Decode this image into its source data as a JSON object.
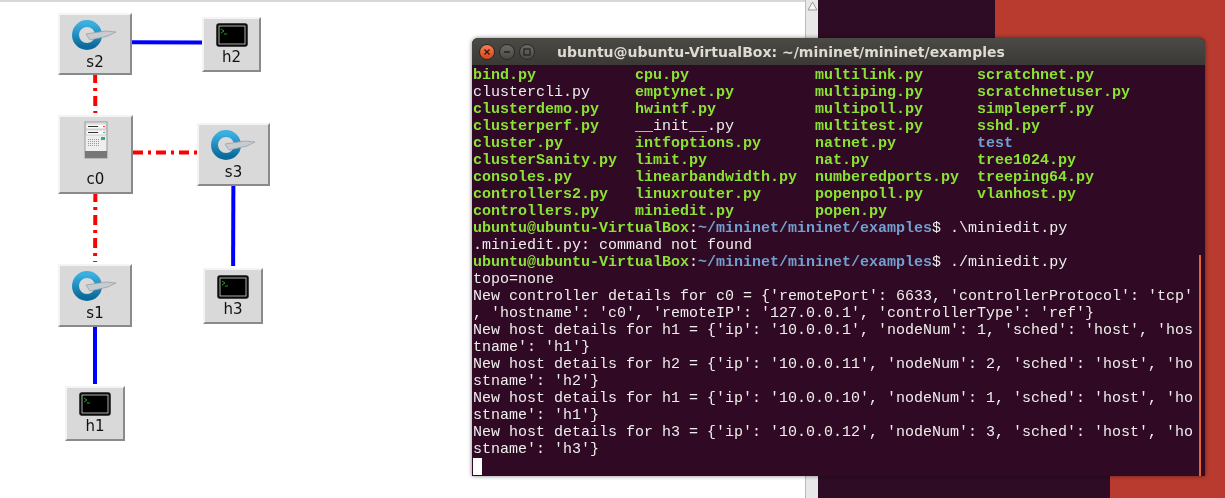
{
  "topology": {
    "nodes": [
      {
        "label": "s2",
        "kind": "switch"
      },
      {
        "label": "h2",
        "kind": "host"
      },
      {
        "label": "c0",
        "kind": "controller"
      },
      {
        "label": "s3",
        "kind": "switch"
      },
      {
        "label": "s1",
        "kind": "switch"
      },
      {
        "label": "h3",
        "kind": "host"
      },
      {
        "label": "h1",
        "kind": "host"
      }
    ],
    "links": [
      {
        "kind": "data"
      },
      {
        "kind": "control"
      },
      {
        "kind": "control"
      },
      {
        "kind": "control"
      },
      {
        "kind": "data"
      },
      {
        "kind": "data"
      }
    ]
  },
  "terminal": {
    "title": "ubuntu@ubuntu-VirtualBox: ~/mininet/mininet/examples",
    "listing": [
      [
        {
          "name": "bind.py",
          "kind": "file"
        },
        {
          "name": "clustercli.py",
          "kind": "plain"
        },
        {
          "name": "clusterdemo.py",
          "kind": "file"
        },
        {
          "name": "clusterperf.py",
          "kind": "file"
        },
        {
          "name": "cluster.py",
          "kind": "file"
        },
        {
          "name": "clusterSanity.py",
          "kind": "file"
        },
        {
          "name": "consoles.py",
          "kind": "file"
        },
        {
          "name": "controllers2.py",
          "kind": "file"
        },
        {
          "name": "controllers.py",
          "kind": "file"
        }
      ],
      [
        {
          "name": "cpu.py",
          "kind": "file"
        },
        {
          "name": "emptynet.py",
          "kind": "file"
        },
        {
          "name": "hwintf.py",
          "kind": "file"
        },
        {
          "name": "__init__.py",
          "kind": "plain"
        },
        {
          "name": "intfoptions.py",
          "kind": "file"
        },
        {
          "name": "limit.py",
          "kind": "file"
        },
        {
          "name": "linearbandwidth.py",
          "kind": "file"
        },
        {
          "name": "linuxrouter.py",
          "kind": "file"
        },
        {
          "name": "miniedit.py",
          "kind": "file"
        }
      ],
      [
        {
          "name": "multilink.py",
          "kind": "file"
        },
        {
          "name": "multiping.py",
          "kind": "file"
        },
        {
          "name": "multipoll.py",
          "kind": "file"
        },
        {
          "name": "multitest.py",
          "kind": "file"
        },
        {
          "name": "natnet.py",
          "kind": "file"
        },
        {
          "name": "nat.py",
          "kind": "file"
        },
        {
          "name": "numberedports.py",
          "kind": "file"
        },
        {
          "name": "popenpoll.py",
          "kind": "file"
        },
        {
          "name": "popen.py",
          "kind": "file"
        }
      ],
      [
        {
          "name": "scratchnet.py",
          "kind": "file"
        },
        {
          "name": "scratchnetuser.py",
          "kind": "file"
        },
        {
          "name": "simpleperf.py",
          "kind": "file"
        },
        {
          "name": "sshd.py",
          "kind": "file"
        },
        {
          "name": "test",
          "kind": "dir"
        },
        {
          "name": "tree1024.py",
          "kind": "file"
        },
        {
          "name": "treeping64.py",
          "kind": "file"
        },
        {
          "name": "vlanhost.py",
          "kind": "file"
        }
      ]
    ],
    "lines": [
      {
        "kind": "prompt",
        "user": "ubuntu@ubuntu-VirtualBox",
        "separator": ":",
        "path": "~/mininet/mininet/examples",
        "symbol": "$",
        "command": ".\\miniedit.py"
      },
      {
        "kind": "output",
        "text": ".miniedit.py: command not found"
      },
      {
        "kind": "prompt",
        "user": "ubuntu@ubuntu-VirtualBox",
        "separator": ":",
        "path": "~/mininet/mininet/examples",
        "symbol": "$",
        "command": "./miniedit.py"
      },
      {
        "kind": "output",
        "text": "topo=none"
      },
      {
        "kind": "output",
        "text": "New controller details for c0 = {'remotePort': 6633, 'controllerProtocol': 'tcp'"
      },
      {
        "kind": "output",
        "text": ", 'hostname': 'c0', 'remoteIP': '127.0.0.1', 'controllerType': 'ref'}"
      },
      {
        "kind": "output",
        "text": "New host details for h1 = {'ip': '10.0.0.1', 'nodeNum': 1, 'sched': 'host', 'hos"
      },
      {
        "kind": "output",
        "text": "tname': 'h1'}"
      },
      {
        "kind": "output",
        "text": "New host details for h2 = {'ip': '10.0.0.11', 'nodeNum': 2, 'sched': 'host', 'ho"
      },
      {
        "kind": "output",
        "text": "stname': 'h2'}"
      },
      {
        "kind": "output",
        "text": "New host details for h1 = {'ip': '10.0.0.10', 'nodeNum': 1, 'sched': 'host', 'ho"
      },
      {
        "kind": "output",
        "text": "stname': 'h1'}"
      },
      {
        "kind": "output",
        "text": "New host details for h3 = {'ip': '10.0.0.12', 'nodeNum': 3, 'sched': 'host', 'ho"
      },
      {
        "kind": "output",
        "text": "stname': 'h3'}"
      }
    ],
    "cursor": true
  }
}
